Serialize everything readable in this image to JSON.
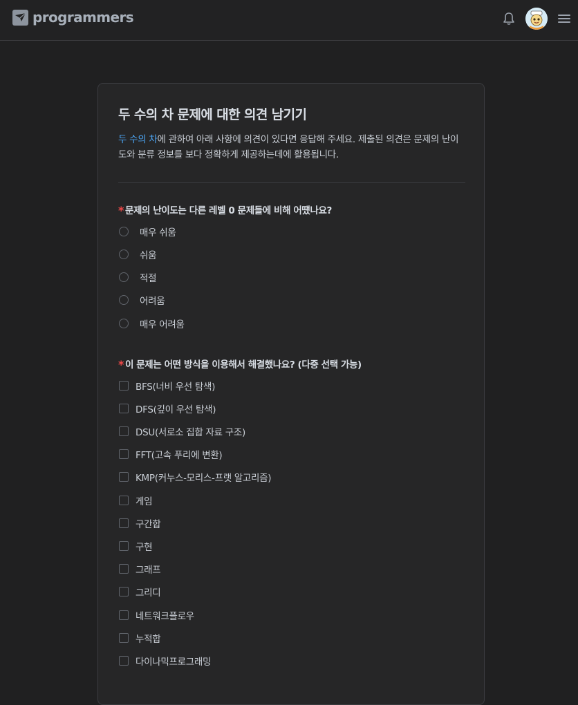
{
  "header": {
    "logo_text": "programmers",
    "icons": [
      "logo-icon",
      "bell-icon",
      "avatar",
      "hamburger-menu-icon"
    ]
  },
  "form": {
    "title": "두 수의 차 문제에 대한 의견 남기기",
    "description_link": "두 수의 차",
    "description_rest": "에 관하여 아래 사항에 의견이 있다면 응답해 주세요. 제출된 의견은 문제의 난이도와 분류 정보를 보다 정확하게 제공하는데에 활용됩니다.",
    "required_mark": "*",
    "q1": {
      "label": "문제의 난이도는 다른 레벨 0 문제들에 비해 어떘나요?",
      "options": [
        "매우 쉬움",
        "쉬움",
        "적절",
        "어려움",
        "매우 어려움"
      ]
    },
    "q2": {
      "label": "이 문제는 어떤 방식을 이용해서 해결했나요? (다중 선택 가능)",
      "options": [
        "BFS(너비 우선 탐색)",
        "DFS(깊이 우선 탐색)",
        "DSU(서로소 집합 자료 구조)",
        "FFT(고속 푸리에 변환)",
        "KMP(커누스-모리스-프랫 알고리즘)",
        "게임",
        "구간합",
        "구현",
        "그래프",
        "그리디",
        "네트워크플로우",
        "누적합",
        "다이나믹프로그래밍"
      ]
    }
  },
  "colors": {
    "background": "#202021",
    "card": "#262627",
    "link": "#4ba3f0",
    "required": "#f04848"
  }
}
